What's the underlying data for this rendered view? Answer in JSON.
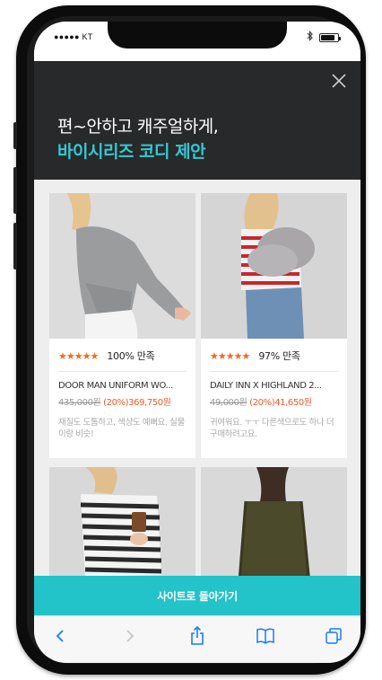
{
  "status_bar": {
    "carrier": "●●●●● KT",
    "bluetooth_icon": "bluetooth-icon",
    "battery_level": 0.85
  },
  "banner": {
    "line1": "편~안하고 캐주얼하게,",
    "line2": "바이시리즈 코디 제안",
    "close_icon": "close-icon",
    "colors": {
      "background": "#27292b",
      "accent": "#35c8d2",
      "text": "#ffffff"
    }
  },
  "products": [
    {
      "stars": "★★★★★",
      "rating": "100% 만족",
      "name": "DOOR MAN UNIFORM WO...",
      "original_price": "435,000원",
      "sale_price": "(20%)369,750원",
      "review": "재질도 도톰하고, 색상도 예뻐요. 실물이랑 비슷!",
      "image": "model-grey-sweater-photo"
    },
    {
      "stars": "★★★★★",
      "rating": "97% 만족",
      "name": "DAILY INN X HIGHLAND 2...",
      "original_price": "49,000원",
      "sale_price": "(20%)41,650원",
      "review": "귀여워요. ㅜㅜ 다른색으로도 하나 더 구매하려고요.",
      "image": "model-striped-top-fur-photo"
    },
    {
      "image": "model-striped-sweater-coffee-photo"
    },
    {
      "image": "model-olive-knit-photo"
    }
  ],
  "cta": {
    "label": "사이트로 돌아가기",
    "color": "#22c3c9"
  },
  "toolbar": {
    "icons": [
      "back-arrow-icon",
      "forward-arrow-icon",
      "share-icon",
      "bookmarks-icon",
      "tabs-icon"
    ],
    "accent": "#1a7cf5"
  },
  "colors": {
    "star": "#ef6c1f",
    "sale": "#ee5a24"
  }
}
